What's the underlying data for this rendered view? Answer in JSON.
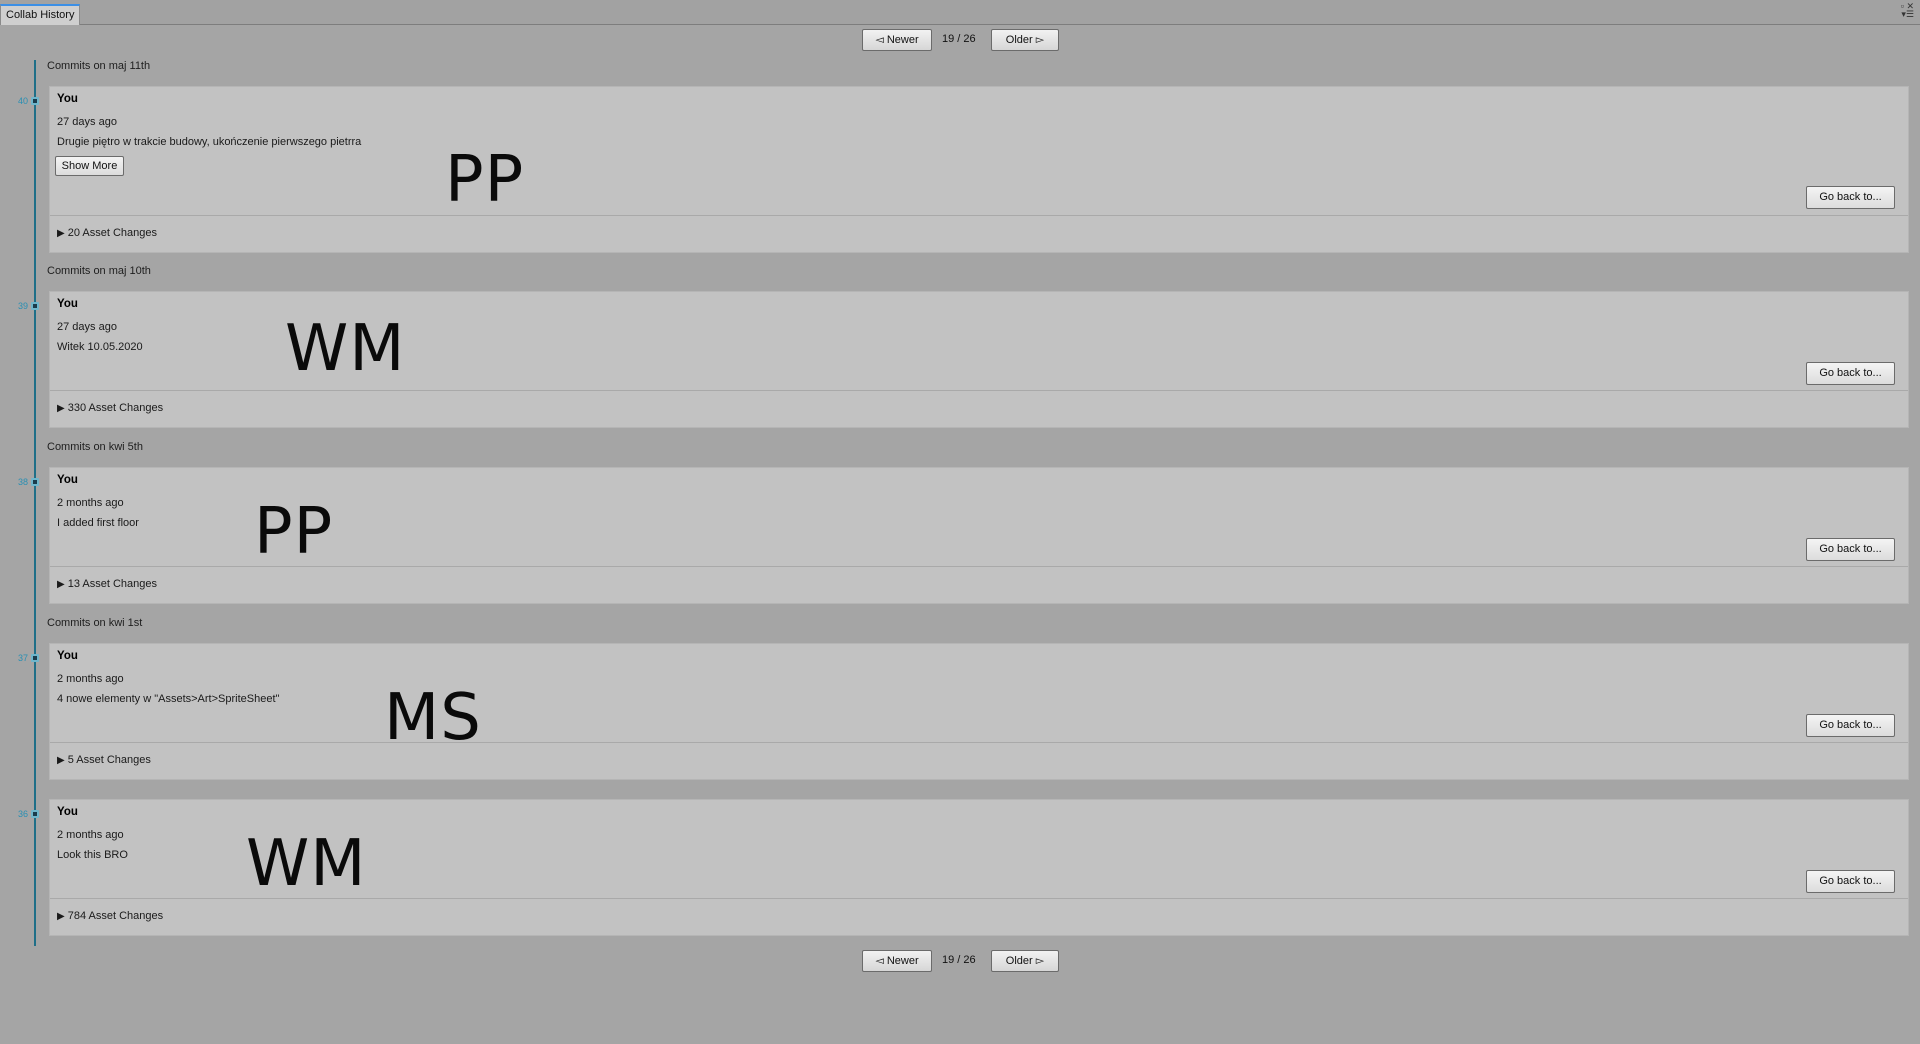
{
  "tab": {
    "title": "Collab History"
  },
  "pager": {
    "newer_label": "◅ Newer",
    "older_label": "Older ▻",
    "count": "19 / 26"
  },
  "commits": [
    {
      "date_header": "Commits on maj 11th",
      "rev": "40",
      "author": "You",
      "time": "27 days ago",
      "message": "Drugie piętro w trakcie budowy, ukończenie pierwszego pietrra",
      "show_more": "Show More",
      "assets": "20 Asset Changes",
      "go_back": "Go back to...",
      "initials": "PP"
    },
    {
      "date_header": "Commits on maj 10th",
      "rev": "39",
      "author": "You",
      "time": "27 days ago",
      "message": "Witek 10.05.2020",
      "assets": "330 Asset Changes",
      "go_back": "Go back to...",
      "initials": "WM"
    },
    {
      "date_header": "Commits on kwi 5th",
      "rev": "38",
      "author": "You",
      "time": "2 months ago",
      "message": "I added first floor",
      "assets": "13 Asset Changes",
      "go_back": "Go back to...",
      "initials": "PP"
    },
    {
      "date_header": "Commits on kwi 1st",
      "rev": "37",
      "author": "You",
      "time": "2 months ago",
      "message": "4 nowe elementy w \"Assets>Art>SpriteSheet\"",
      "assets": "5 Asset Changes",
      "go_back": "Go back to...",
      "initials": "MS"
    },
    {
      "date_header": "",
      "rev": "36",
      "author": "You",
      "time": "2 months ago",
      "message": "Look this BRO",
      "assets": "784 Asset Changes",
      "go_back": "Go back to...",
      "initials": "WM"
    }
  ]
}
